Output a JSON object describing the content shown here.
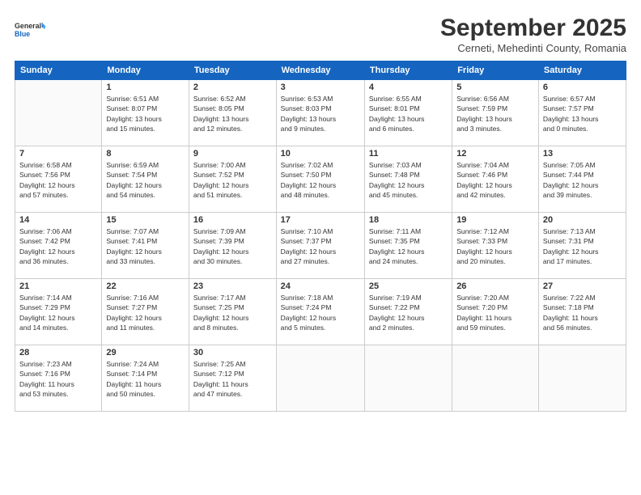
{
  "logo": {
    "line1": "General",
    "line2": "Blue"
  },
  "header": {
    "month": "September 2025",
    "location": "Cerneti, Mehedinti County, Romania"
  },
  "days_of_week": [
    "Sunday",
    "Monday",
    "Tuesday",
    "Wednesday",
    "Thursday",
    "Friday",
    "Saturday"
  ],
  "weeks": [
    [
      {
        "day": "",
        "info": ""
      },
      {
        "day": "1",
        "info": "Sunrise: 6:51 AM\nSunset: 8:07 PM\nDaylight: 13 hours\nand 15 minutes."
      },
      {
        "day": "2",
        "info": "Sunrise: 6:52 AM\nSunset: 8:05 PM\nDaylight: 13 hours\nand 12 minutes."
      },
      {
        "day": "3",
        "info": "Sunrise: 6:53 AM\nSunset: 8:03 PM\nDaylight: 13 hours\nand 9 minutes."
      },
      {
        "day": "4",
        "info": "Sunrise: 6:55 AM\nSunset: 8:01 PM\nDaylight: 13 hours\nand 6 minutes."
      },
      {
        "day": "5",
        "info": "Sunrise: 6:56 AM\nSunset: 7:59 PM\nDaylight: 13 hours\nand 3 minutes."
      },
      {
        "day": "6",
        "info": "Sunrise: 6:57 AM\nSunset: 7:57 PM\nDaylight: 13 hours\nand 0 minutes."
      }
    ],
    [
      {
        "day": "7",
        "info": "Sunrise: 6:58 AM\nSunset: 7:56 PM\nDaylight: 12 hours\nand 57 minutes."
      },
      {
        "day": "8",
        "info": "Sunrise: 6:59 AM\nSunset: 7:54 PM\nDaylight: 12 hours\nand 54 minutes."
      },
      {
        "day": "9",
        "info": "Sunrise: 7:00 AM\nSunset: 7:52 PM\nDaylight: 12 hours\nand 51 minutes."
      },
      {
        "day": "10",
        "info": "Sunrise: 7:02 AM\nSunset: 7:50 PM\nDaylight: 12 hours\nand 48 minutes."
      },
      {
        "day": "11",
        "info": "Sunrise: 7:03 AM\nSunset: 7:48 PM\nDaylight: 12 hours\nand 45 minutes."
      },
      {
        "day": "12",
        "info": "Sunrise: 7:04 AM\nSunset: 7:46 PM\nDaylight: 12 hours\nand 42 minutes."
      },
      {
        "day": "13",
        "info": "Sunrise: 7:05 AM\nSunset: 7:44 PM\nDaylight: 12 hours\nand 39 minutes."
      }
    ],
    [
      {
        "day": "14",
        "info": "Sunrise: 7:06 AM\nSunset: 7:42 PM\nDaylight: 12 hours\nand 36 minutes."
      },
      {
        "day": "15",
        "info": "Sunrise: 7:07 AM\nSunset: 7:41 PM\nDaylight: 12 hours\nand 33 minutes."
      },
      {
        "day": "16",
        "info": "Sunrise: 7:09 AM\nSunset: 7:39 PM\nDaylight: 12 hours\nand 30 minutes."
      },
      {
        "day": "17",
        "info": "Sunrise: 7:10 AM\nSunset: 7:37 PM\nDaylight: 12 hours\nand 27 minutes."
      },
      {
        "day": "18",
        "info": "Sunrise: 7:11 AM\nSunset: 7:35 PM\nDaylight: 12 hours\nand 24 minutes."
      },
      {
        "day": "19",
        "info": "Sunrise: 7:12 AM\nSunset: 7:33 PM\nDaylight: 12 hours\nand 20 minutes."
      },
      {
        "day": "20",
        "info": "Sunrise: 7:13 AM\nSunset: 7:31 PM\nDaylight: 12 hours\nand 17 minutes."
      }
    ],
    [
      {
        "day": "21",
        "info": "Sunrise: 7:14 AM\nSunset: 7:29 PM\nDaylight: 12 hours\nand 14 minutes."
      },
      {
        "day": "22",
        "info": "Sunrise: 7:16 AM\nSunset: 7:27 PM\nDaylight: 12 hours\nand 11 minutes."
      },
      {
        "day": "23",
        "info": "Sunrise: 7:17 AM\nSunset: 7:25 PM\nDaylight: 12 hours\nand 8 minutes."
      },
      {
        "day": "24",
        "info": "Sunrise: 7:18 AM\nSunset: 7:24 PM\nDaylight: 12 hours\nand 5 minutes."
      },
      {
        "day": "25",
        "info": "Sunrise: 7:19 AM\nSunset: 7:22 PM\nDaylight: 12 hours\nand 2 minutes."
      },
      {
        "day": "26",
        "info": "Sunrise: 7:20 AM\nSunset: 7:20 PM\nDaylight: 11 hours\nand 59 minutes."
      },
      {
        "day": "27",
        "info": "Sunrise: 7:22 AM\nSunset: 7:18 PM\nDaylight: 11 hours\nand 56 minutes."
      }
    ],
    [
      {
        "day": "28",
        "info": "Sunrise: 7:23 AM\nSunset: 7:16 PM\nDaylight: 11 hours\nand 53 minutes."
      },
      {
        "day": "29",
        "info": "Sunrise: 7:24 AM\nSunset: 7:14 PM\nDaylight: 11 hours\nand 50 minutes."
      },
      {
        "day": "30",
        "info": "Sunrise: 7:25 AM\nSunset: 7:12 PM\nDaylight: 11 hours\nand 47 minutes."
      },
      {
        "day": "",
        "info": ""
      },
      {
        "day": "",
        "info": ""
      },
      {
        "day": "",
        "info": ""
      },
      {
        "day": "",
        "info": ""
      }
    ]
  ]
}
